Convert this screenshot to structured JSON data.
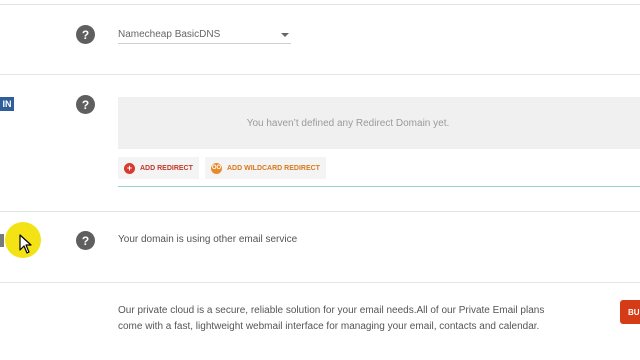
{
  "nameservers": {
    "help": "?",
    "selected": "Namecheap BasicDNS"
  },
  "redirect": {
    "left_label": "IN",
    "help": "?",
    "empty_message": "You haven’t defined any Redirect Domain yet.",
    "add_redirect_label": "ADD REDIRECT",
    "add_wildcard_label": "ADD WILDCARD REDIRECT",
    "add_redirect_icon": "+",
    "add_wildcard_icon": "oo"
  },
  "email": {
    "help": "?",
    "status_text": "Your domain is using other email service"
  },
  "private_email": {
    "description": "Our private cloud is a secure, reliable solution for your email needs.All of our Private Email plans come with a fast, lightweight webmail interface for managing your email, contacts and calendar.",
    "buy_label": "BU"
  },
  "colors": {
    "add_redirect": "#d83a2e",
    "add_wildcard": "#e98a2a",
    "buy": "#d43b16",
    "cursor_highlight": "#f4e314"
  }
}
